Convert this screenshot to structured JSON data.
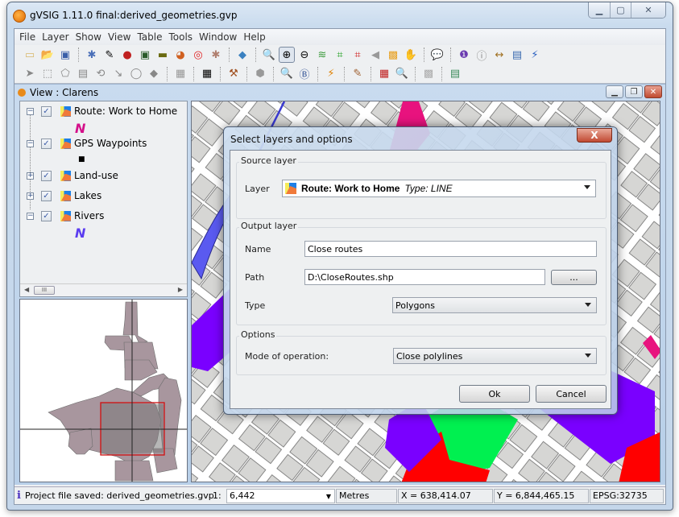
{
  "window": {
    "title": "gVSIG 1.11.0 final:derived_geometries.gvp",
    "caption_buttons": [
      "minimize",
      "maximize",
      "close"
    ]
  },
  "menubar": {
    "items": [
      "File",
      "Layer",
      "Show",
      "View",
      "Table",
      "Tools",
      "Window",
      "Help"
    ]
  },
  "toolbar": {
    "row1_icons": [
      "new-project-icon",
      "open-project-icon",
      "save-project-icon",
      "add-layer-icon",
      "edit-icon",
      "network-icon",
      "console-icon",
      "battery-icon",
      "geoprocess-icon",
      "target-icon",
      "gear-icon",
      "add-data-icon",
      "zoom-previous-icon",
      "zoom-in-icon",
      "zoom-out-icon",
      "layers-icon",
      "zoom-extent-icon",
      "zoom-full-icon",
      "pan-select-icon",
      "overlay-icon",
      "pan-hand-icon",
      "tooltip-icon",
      "info-pointer-icon",
      "info-icon",
      "measure-distance-icon",
      "measure-area-icon",
      "hyperlink-icon"
    ],
    "row2_icons": [
      "select-icon",
      "select-rect-icon",
      "select-poly-icon",
      "table-icon",
      "swap-icon",
      "select-line-icon",
      "select-circle-icon",
      "select-shape-icon",
      "table-gray-icon",
      "grid-icon",
      "tools-icon",
      "dots-icon",
      "locate-icon",
      "locate-b-icon",
      "lightning-icon",
      "edit-legend-icon",
      "calendar-icon",
      "find-icon",
      "disabled-icon",
      "export-table-icon"
    ]
  },
  "view": {
    "title": "View : Clarens",
    "toc": {
      "layers": [
        {
          "name": "Route: Work to Home",
          "expanded": true,
          "checked": true,
          "symbol": "N",
          "symbol_color": "#d4108a"
        },
        {
          "name": "GPS Waypoints",
          "expanded": true,
          "checked": true,
          "symbol": "■",
          "symbol_color": "#000000"
        },
        {
          "name": "Land-use",
          "expanded": false,
          "checked": true
        },
        {
          "name": "Lakes",
          "expanded": false,
          "checked": true
        },
        {
          "name": "Rivers",
          "expanded": true,
          "checked": true,
          "symbol": "N",
          "symbol_color": "#5a3cf0"
        }
      ],
      "scroll_thumb_label": "III"
    }
  },
  "dialog": {
    "title": "Select layers and options",
    "close_label": "X",
    "source_group": "Source layer",
    "layer_label": "Layer",
    "layer_value": "Route: Work to Home",
    "layer_type": "Type: LINE",
    "output_group": "Output layer",
    "name_label": "Name",
    "name_value": "Close routes",
    "path_label": "Path",
    "path_value": "D:\\CloseRoutes.shp",
    "browse_label": "...",
    "type_label": "Type",
    "type_value": "Polygons",
    "options_group": "Options",
    "mode_label": "Mode of operation:",
    "mode_value": "Close polylines",
    "ok_label": "Ok",
    "cancel_label": "Cancel"
  },
  "statusbar": {
    "message": "Project file saved: derived_geometries.gvp",
    "scale_prefix": "1:",
    "scale_value": "6,442",
    "units": "Metres",
    "x_coord": "X = 638,414.07",
    "y_coord": "Y = 6,844,465.15",
    "crs": "EPSG:32735"
  },
  "colors": {
    "route": "#e8137e",
    "rivers": "#5a5af0",
    "landuse_purple": "#7a00ff",
    "landuse_green": "#00f050",
    "landuse_red": "#ff0000",
    "parcels": "#d6d6d4",
    "locator_fill": "#a8969e",
    "locator_extent": "#d01010"
  }
}
